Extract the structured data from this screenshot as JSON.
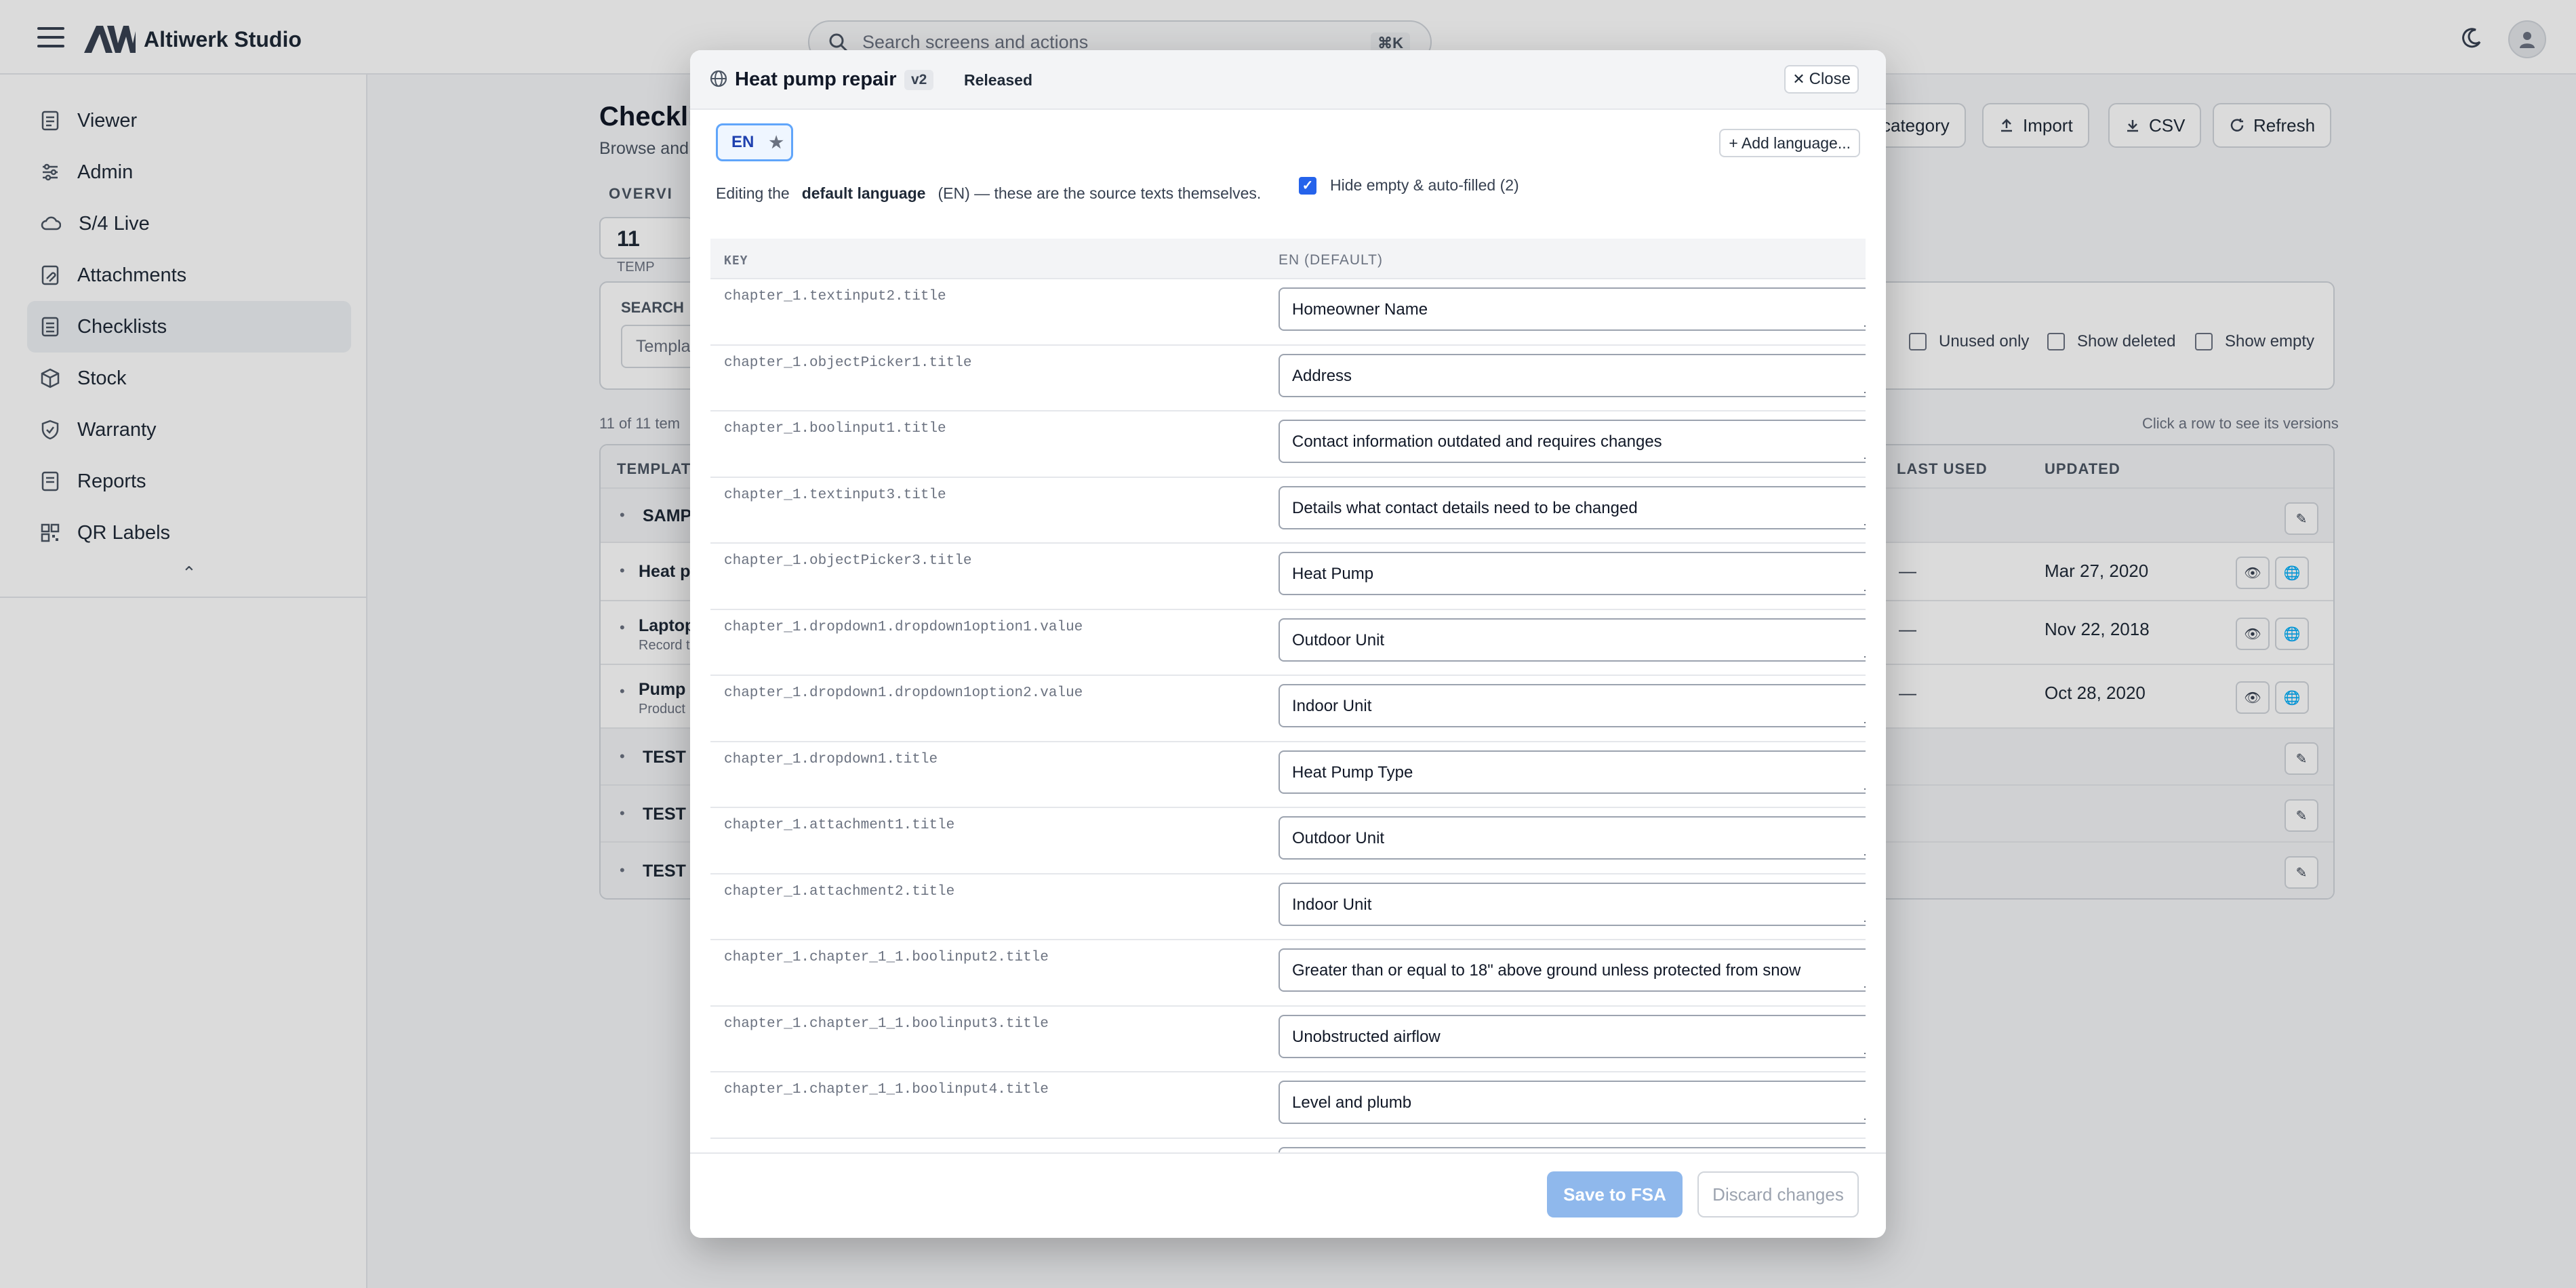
{
  "app": {
    "title": "Altiwerk Studio"
  },
  "search": {
    "placeholder": "Search screens and actions",
    "shortcut": "⌘K"
  },
  "sidebar": {
    "items": [
      {
        "label": "Viewer",
        "icon": "document-icon"
      },
      {
        "label": "Admin",
        "icon": "sliders-icon"
      },
      {
        "label": "S/4 Live",
        "icon": "cloud-icon"
      },
      {
        "label": "Attachments",
        "icon": "attachment-icon"
      },
      {
        "label": "Checklists",
        "icon": "checklist-icon",
        "active": true
      },
      {
        "label": "Stock",
        "icon": "box-icon"
      },
      {
        "label": "Warranty",
        "icon": "shield-icon"
      },
      {
        "label": "Reports",
        "icon": "report-icon"
      },
      {
        "label": "QR Labels",
        "icon": "qr-icon"
      }
    ],
    "collapse": "⌃"
  },
  "page": {
    "title": "Checkli",
    "subtitle": "Browse and",
    "buttons": {
      "category": "category",
      "import": "Import",
      "csv": "CSV",
      "refresh": "Refresh"
    },
    "overview": "OVERVI",
    "stat_value": "11",
    "stat_label": "TEMP",
    "search_label": "SEARCH",
    "search_value": "Templa",
    "filters": {
      "unused": "Unused only",
      "deleted": "Show deleted",
      "empty": "Show empty"
    },
    "count_text": "11 of 11 tem",
    "hint_text": "Click a row to see its versions",
    "columns": {
      "template": "TEMPLATE",
      "last_used": "LAST USED",
      "updated": "UPDATED"
    },
    "rows": [
      {
        "name": "SAMP",
        "group": true,
        "desc": "",
        "last_used": "",
        "updated": ""
      },
      {
        "name": "Heat p",
        "group": false,
        "desc": "",
        "last_used": "—",
        "updated": "Mar 27, 2020"
      },
      {
        "name": "Laptop",
        "group": false,
        "desc": "Record t",
        "last_used": "—",
        "updated": "Nov 22, 2018"
      },
      {
        "name": "Pump",
        "group": false,
        "desc": "Product",
        "last_used": "—",
        "updated": "Oct 28, 2020"
      },
      {
        "name": "TEST",
        "group": true,
        "desc": "",
        "last_used": "",
        "updated": ""
      },
      {
        "name": "TEST",
        "group": true,
        "desc": "",
        "last_used": "",
        "updated": ""
      },
      {
        "name": "TEST",
        "group": true,
        "desc": "",
        "last_used": "",
        "updated": ""
      }
    ]
  },
  "modal": {
    "title": "Heat pump repair",
    "version": "v2",
    "status": "Released",
    "close_label": "Close",
    "language_chip": "EN",
    "add_language": "+ Add language...",
    "info_prefix": "Editing the",
    "info_bold": "default language",
    "info_suffix": "(EN) — these are the source texts themselves.",
    "hide_empty_label": "Hide empty & auto-filled (2)",
    "hide_empty_checked": true,
    "col_key": "KEY",
    "col_value": "EN (DEFAULT)",
    "rows": [
      {
        "key": "chapter_1.textinput2.title",
        "value": "Homeowner Name"
      },
      {
        "key": "chapter_1.objectPicker1.title",
        "value": "Address"
      },
      {
        "key": "chapter_1.boolinput1.title",
        "value": "Contact information outdated and requires changes"
      },
      {
        "key": "chapter_1.textinput3.title",
        "value": "Details what contact details need to be changed"
      },
      {
        "key": "chapter_1.objectPicker3.title",
        "value": "Heat Pump"
      },
      {
        "key": "chapter_1.dropdown1.dropdown1option1.value",
        "value": "Outdoor Unit"
      },
      {
        "key": "chapter_1.dropdown1.dropdown1option2.value",
        "value": "Indoor Unit"
      },
      {
        "key": "chapter_1.dropdown1.title",
        "value": "Heat Pump Type"
      },
      {
        "key": "chapter_1.attachment1.title",
        "value": "Outdoor Unit"
      },
      {
        "key": "chapter_1.attachment2.title",
        "value": "Indoor Unit"
      },
      {
        "key": "chapter_1.chapter_1_1.boolinput2.title",
        "value": "Greater than or equal to 18\" above ground unless protected from snow"
      },
      {
        "key": "chapter_1.chapter_1_1.boolinput3.title",
        "value": "Unobstructed airflow"
      },
      {
        "key": "chapter_1.chapter_1_1.boolinput4.title",
        "value": "Level and plumb"
      },
      {
        "key": "",
        "value": ""
      }
    ],
    "save_label": "Save to FSA",
    "discard_label": "Discard changes"
  },
  "colors": {
    "accent": "#2563eb",
    "save_disabled": "#8fb8ec",
    "chip_border": "#60a5fa"
  }
}
